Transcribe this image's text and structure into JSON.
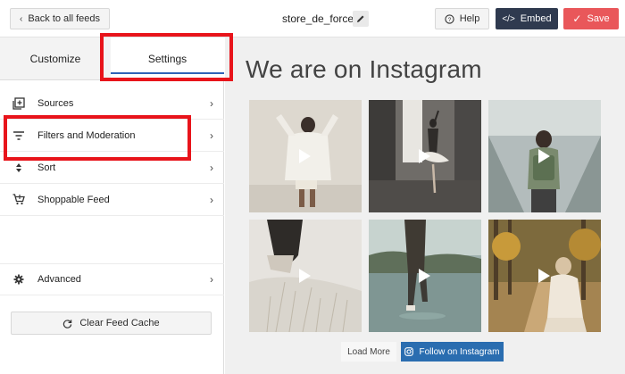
{
  "header": {
    "back_label": "Back to all feeds",
    "feed_name": "store_de_force",
    "help_label": "Help",
    "embed_label": "Embed",
    "save_label": "Save"
  },
  "sidebar": {
    "tabs": [
      {
        "label": "Customize",
        "active": false
      },
      {
        "label": "Settings",
        "active": true
      }
    ],
    "items": [
      {
        "label": "Sources",
        "icon": "add-to-library-icon"
      },
      {
        "label": "Filters and Moderation",
        "icon": "filter-icon"
      },
      {
        "label": "Sort",
        "icon": "sort-icon"
      },
      {
        "label": "Shoppable Feed",
        "icon": "shopping-cart-icon"
      },
      {
        "label": "Advanced",
        "icon": "gear-icon"
      }
    ],
    "clear_cache_label": "Clear Feed Cache"
  },
  "preview": {
    "title": "We are on Instagram",
    "posts": [
      {
        "type": "video",
        "scene": "woman in white shirt"
      },
      {
        "type": "video",
        "scene": "ballet dancer in studio"
      },
      {
        "type": "video",
        "scene": "person with backpack on escalator"
      },
      {
        "type": "video",
        "scene": "legs in beach grass"
      },
      {
        "type": "video",
        "scene": "person walking in water"
      },
      {
        "type": "video",
        "scene": "woman in autumn park"
      }
    ],
    "load_more_label": "Load More",
    "follow_label": "Follow on Instagram"
  },
  "colors": {
    "embed_bg": "#2f3a4f",
    "save_bg": "#e9575a",
    "follow_bg": "#2a6db0",
    "tab_underline": "#2f63b7",
    "highlight": "#e8141b"
  }
}
